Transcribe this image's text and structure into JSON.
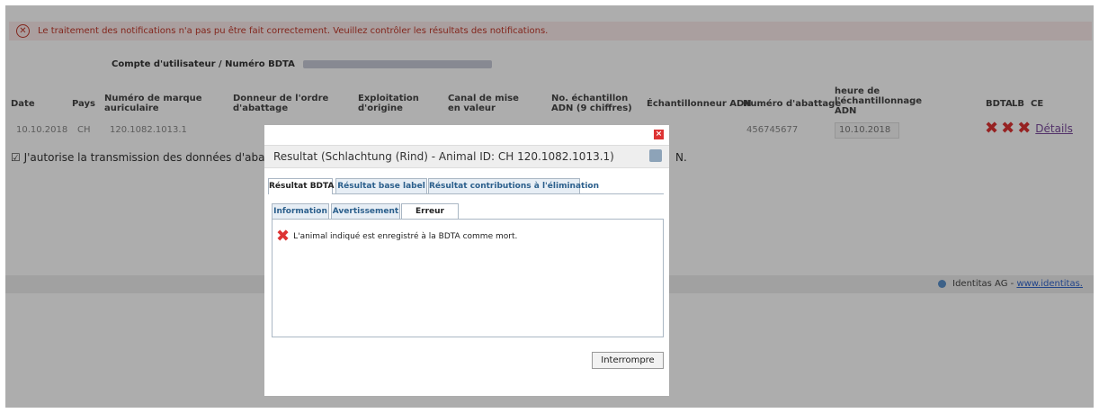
{
  "alert": {
    "text": "Le traitement des notifications n'a pas pu être fait correctement. Veuillez contrôler les résultats des notifications."
  },
  "account": {
    "label": "Compte d'utilisateur / Numéro BDTA"
  },
  "table": {
    "headers": {
      "date": "Date",
      "pays": "Pays",
      "marque": "Numéro de marque auriculaire",
      "donneur": "Donneur de l'ordre d'abattage",
      "exploitation": "Exploitation d'origine",
      "canal": "Canal de mise en valeur",
      "echantillon": "No. échantillon ADN (9 chiffres)",
      "echantillonneur": "Échantillonneur ADN",
      "abattage": "Numéro d'abattage",
      "heure": "heure de l'échantillonnage ADN",
      "bdta": "BDTA",
      "lb": "LB",
      "ce": "CE"
    },
    "row": {
      "date": "10.10.2018",
      "pays": "CH",
      "marque": "120.1082.1013.1",
      "abattage": "456745677",
      "heure": "10.10.2018",
      "details": "Détails"
    }
  },
  "authorization": {
    "text": "J'autorise la transmission des données d'abattage",
    "suffix": "N."
  },
  "footer": {
    "company": "Identitas AG - ",
    "link": "www.identitas."
  },
  "modal": {
    "title": "Resultat (Schlachtung (Rind) - Animal ID: CH 120.1082.1013.1)",
    "tabs_top": [
      "Résultat BDTA",
      "Résultat base label",
      "Résultat contributions à l'élimination"
    ],
    "tabs_sub": [
      "Information",
      "Avertissement",
      "Erreur"
    ],
    "error_message": "L'animal indiqué est enregistré à la BDTA comme mort.",
    "abort_label": "Interrompre"
  },
  "icons": {
    "error": "error-x-icon",
    "print": "print-icon",
    "close": "close-icon",
    "alert": "alert-circle-icon"
  },
  "colors": {
    "error": "#dd3333",
    "alert_bg": "#fbeaea",
    "link": "#7b4b9c",
    "tab": "#2b5f8c"
  }
}
